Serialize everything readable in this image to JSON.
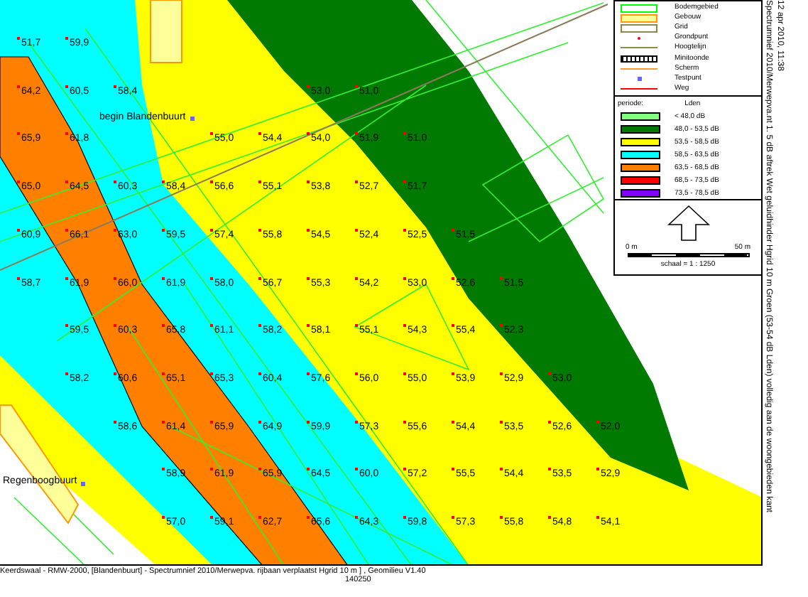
{
  "map": {
    "place_labels": [
      "begin Blandenbuurt",
      "Regenboogbuurt"
    ],
    "grid_rows": [
      [
        "51,7",
        "59,9",
        null,
        null,
        null,
        null,
        null,
        null,
        null,
        null,
        null,
        null,
        null
      ],
      [
        "64,2",
        "60,5",
        "58,4",
        null,
        null,
        null,
        "53,0",
        "51,0",
        null,
        null,
        null,
        null,
        null
      ],
      [
        "65,9",
        "61,8",
        null,
        null,
        "55,0",
        "54,4",
        "54,0",
        "51,9",
        "51,0",
        null,
        null,
        null,
        null
      ],
      [
        "65,0",
        "64,5",
        "60,3",
        "58,4",
        "56,6",
        "55,1",
        "53,8",
        "52,7",
        "51,7",
        null,
        null,
        null,
        null
      ],
      [
        "60,9",
        "66,1",
        "63,0",
        "59,5",
        "57,4",
        "55,8",
        "54,5",
        "52,4",
        "52,5",
        "51,5",
        null,
        null,
        null
      ],
      [
        "58,7",
        "61,9",
        "66,0",
        "61,9",
        "58,0",
        "56,7",
        "55,3",
        "54,2",
        "53,0",
        "52,6",
        "51,5",
        null,
        null
      ],
      [
        null,
        "59,5",
        "60,3",
        "65,8",
        "61,1",
        "58,2",
        "58,1",
        "55,1",
        "54,3",
        "55,4",
        "52,3",
        null,
        null
      ],
      [
        null,
        "58,2",
        "60,6",
        "65,1",
        "65,3",
        "60,4",
        "57,6",
        "56,0",
        "55,0",
        "53,9",
        "52,9",
        "53,0",
        null
      ],
      [
        null,
        null,
        "58,6",
        "61,4",
        "65,9",
        "64,9",
        "59,9",
        "57,3",
        "55,6",
        "54,4",
        "53,5",
        "52,6",
        "52,0"
      ],
      [
        null,
        null,
        null,
        "58,9",
        "61,9",
        "65,9",
        "64,5",
        "60,0",
        "57,2",
        "55,5",
        "54,4",
        "53,5",
        "52,9"
      ],
      [
        null,
        null,
        null,
        "57,0",
        "59,1",
        "62,7",
        "65,6",
        "64,3",
        "59,8",
        "57,3",
        "55,8",
        "54,8",
        "54,1"
      ]
    ],
    "x_tick": "140250",
    "caption": "Keerdswaal - RMW-2000, [Blandenbuurt] - Spectrumnief 2010/Merwepva. rijbaan verplaatst Hgrid 10 m ] , Geomilieu V1.40"
  },
  "legend": {
    "items": [
      {
        "label": "Bodemgebied",
        "kind": "outline",
        "color": "#00ff00"
      },
      {
        "label": "Gebouw",
        "kind": "building",
        "color": "#ff9900"
      },
      {
        "label": "Grid",
        "kind": "outline",
        "color": "#8b8b4b"
      },
      {
        "label": "Grondpunt",
        "kind": "dot",
        "color": "#ff0000"
      },
      {
        "label": "Hoogtelijn",
        "kind": "line",
        "color": "#8b8b4b"
      },
      {
        "label": "Minitoonde",
        "kind": "hatched",
        "color": "#000000"
      },
      {
        "label": "Scherm",
        "kind": "line",
        "color": "#ff9933"
      },
      {
        "label": "Testpunt",
        "kind": "square",
        "color": "#6666ff"
      },
      {
        "label": "Weg",
        "kind": "line",
        "color": "#ff0000"
      }
    ],
    "period_label": "periode:",
    "period": "Lden",
    "classes": [
      {
        "label": "< 48,0 dB",
        "color": "#80ff80"
      },
      {
        "label": "48,0 - 53,5 dB",
        "color": "#007a00"
      },
      {
        "label": "53,5 - 58,5 dB",
        "color": "#ffff00"
      },
      {
        "label": "58,5 - 63,5 dB",
        "color": "#00ffff"
      },
      {
        "label": "63,5 - 68,5 dB",
        "color": "#ff8000"
      },
      {
        "label": "68,5 - 73,5 dB",
        "color": "#ff0000"
      },
      {
        "label": "73,5 - 78,5 dB",
        "color": "#8000ff"
      }
    ],
    "scale_start": "0 m",
    "scale_end": "50 m",
    "scale": "schaal = 1 : 1250"
  },
  "side_texts": [
    "Spectrumnief 2010/Merwepva.nt 1. 5 dB aftrek Wet geluidhinder Hgrid 10 m Groen (53-54 dB Lden) volledig aan de woongebieden kant",
    "12 apr 2010, 11:38"
  ]
}
